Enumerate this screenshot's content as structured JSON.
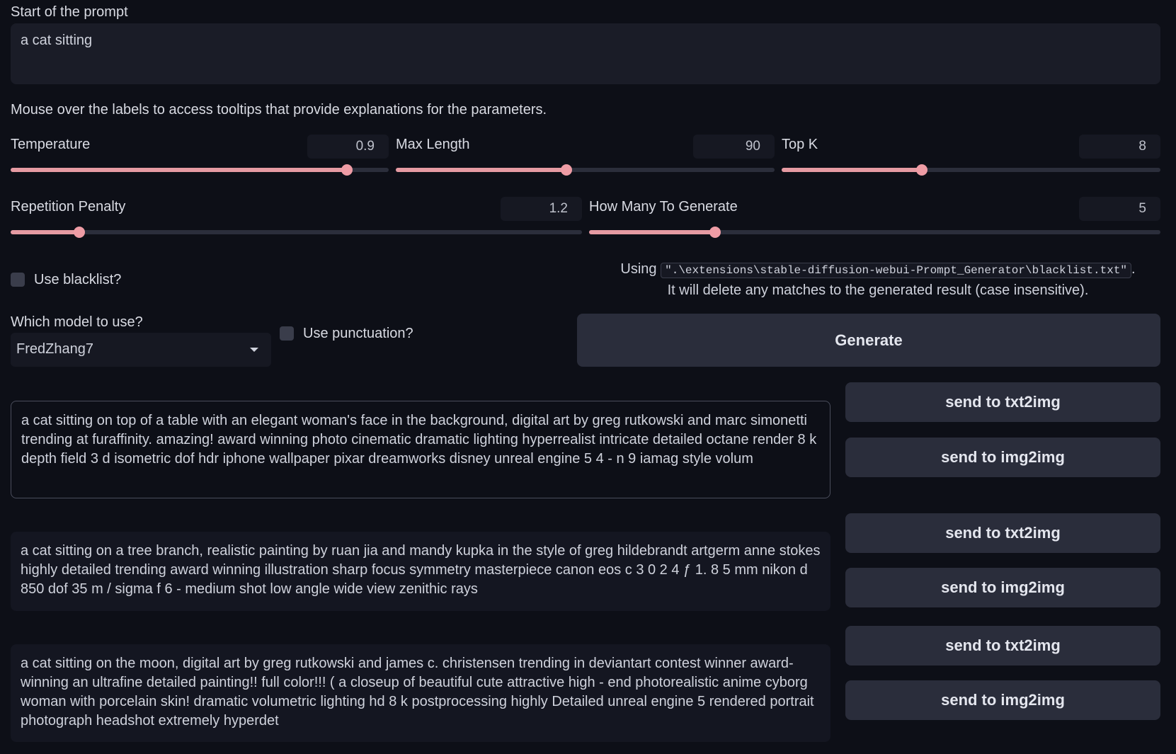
{
  "prompt": {
    "label": "Start of the prompt",
    "value": "a cat sitting"
  },
  "tooltip_note": "Mouse over the labels to access tooltips that provide explanations for the parameters.",
  "sliders": {
    "temperature": {
      "label": "Temperature",
      "value": "0.9",
      "fraction": 0.89
    },
    "max_length": {
      "label": "Max Length",
      "value": "90",
      "fraction": 0.45
    },
    "top_k": {
      "label": "Top K",
      "value": "8",
      "fraction": 0.37
    },
    "repetition_penalty": {
      "label": "Repetition Penalty",
      "value": "1.2",
      "fraction": 0.12
    },
    "how_many": {
      "label": "How Many To Generate",
      "value": "5",
      "fraction": 0.22
    }
  },
  "blacklist": {
    "label": "Use blacklist?",
    "using_prefix": "Using ",
    "path": "\".\\extensions\\stable-diffusion-webui-Prompt_Generator\\blacklist.txt\"",
    "suffix": ".",
    "note": "It will delete any matches to the generated result (case insensitive)."
  },
  "model": {
    "label": "Which model to use?",
    "selected": "FredZhang7"
  },
  "punctuation_label": "Use punctuation?",
  "generate_label": "Generate",
  "results": [
    {
      "text": "a cat sitting on top of a table with an elegant woman's face in the background, digital art by greg rutkowski and marc simonetti trending at furaffinity. amazing! award winning photo cinematic dramatic lighting hyperrealist intricate detailed octane render 8 k depth field 3 d isometric dof hdr iphone wallpaper pixar dreamworks disney unreal engine 5 4 - n 9 iamag style volum",
      "txt2img_label": "send to txt2img",
      "img2img_label": "send to img2img"
    },
    {
      "text": "a cat sitting on a tree branch, realistic painting by ruan jia and mandy kupka in the style of greg hildebrandt artgerm anne stokes highly detailed trending award winning illustration sharp focus symmetry masterpiece canon eos c 3 0 2 4 ƒ 1. 8 5 mm nikon d 850 dof 35 m / sigma f 6 - medium shot low angle wide view zenithic rays",
      "txt2img_label": "send to txt2img",
      "img2img_label": "send to img2img"
    },
    {
      "text": "a cat sitting on the moon, digital art by greg rutkowski and james c. christensen trending in deviantart contest winner award-winning an ultrafine detailed painting!! full color!!! ( a closeup of beautiful cute attractive high - end photorealistic anime cyborg woman with porcelain skin! dramatic volumetric lighting hd 8 k postprocessing highly Detailed unreal engine 5 rendered portrait photograph headshot extremely hyperdet",
      "txt2img_label": "send to txt2img",
      "img2img_label": "send to img2img"
    }
  ],
  "colors": {
    "background": "#0d0f17",
    "accent": "#ee9ca5",
    "button": "#2a2d3b"
  }
}
